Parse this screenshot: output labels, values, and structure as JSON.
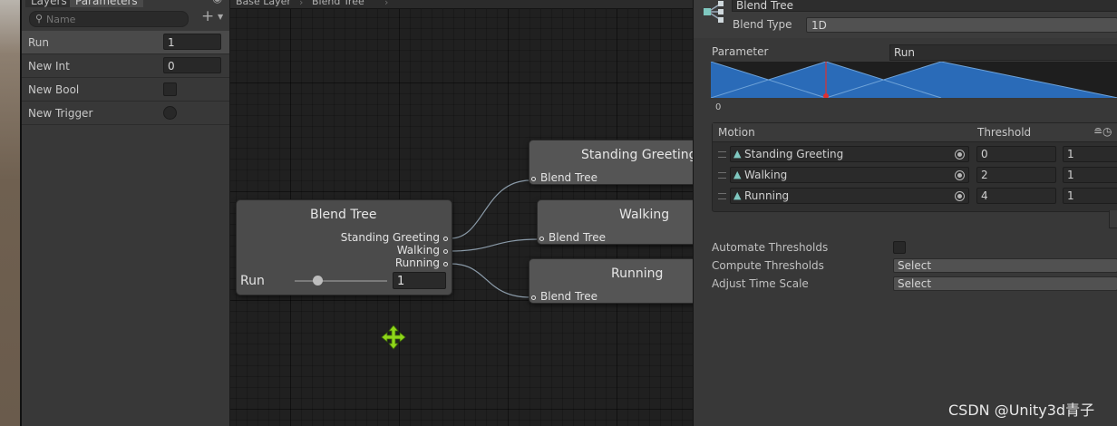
{
  "panel": {
    "tabs": [
      "Layers",
      "Parameters"
    ],
    "search_placeholder": "Name",
    "parameters": [
      {
        "name": "Run",
        "type": "float",
        "value": "1"
      },
      {
        "name": "New Int",
        "type": "int",
        "value": "0"
      },
      {
        "name": "New Bool",
        "type": "bool",
        "value": false
      },
      {
        "name": "New Trigger",
        "type": "trigger",
        "value": false
      }
    ]
  },
  "breadcrumb": [
    "Base Layer",
    "Blend Tree"
  ],
  "graph": {
    "main_node": {
      "title": "Blend Tree",
      "ports": [
        "Standing Greeting",
        "Walking",
        "Running"
      ],
      "parameter_label": "Run",
      "parameter_value": "1",
      "slider_fraction": 0.25
    },
    "child_nodes": [
      {
        "title": "Standing Greeting",
        "port": "Blend Tree"
      },
      {
        "title": "Walking",
        "port": "Blend Tree"
      },
      {
        "title": "Running",
        "port": "Blend Tree"
      }
    ]
  },
  "inspector": {
    "name": "Blend Tree",
    "blend_type_label": "Blend Type",
    "blend_type_value": "1D",
    "parameter_label": "Parameter",
    "parameter_value": "Run",
    "graph_min_label": "0",
    "motion_header": "Motion",
    "threshold_header": "Threshold",
    "motions": [
      {
        "name": "Standing Greeting",
        "threshold": "0",
        "speed": "1"
      },
      {
        "name": "Walking",
        "threshold": "2",
        "speed": "1"
      },
      {
        "name": "Running",
        "threshold": "4",
        "speed": "1"
      }
    ],
    "automate_thresholds_label": "Automate Thresholds",
    "automate_thresholds_checked": false,
    "compute_thresholds_label": "Compute Thresholds",
    "compute_thresholds_value": "Select",
    "adjust_time_scale_label": "Adjust Time Scale",
    "adjust_time_scale_value": "Select"
  },
  "watermark": "CSDN @Unity3d青子",
  "colors": {
    "blend_fill": "#2a6bb8",
    "marker": "#e03030",
    "move_icon": "#8fd61a",
    "motion_icon": "#7fc8c0"
  }
}
